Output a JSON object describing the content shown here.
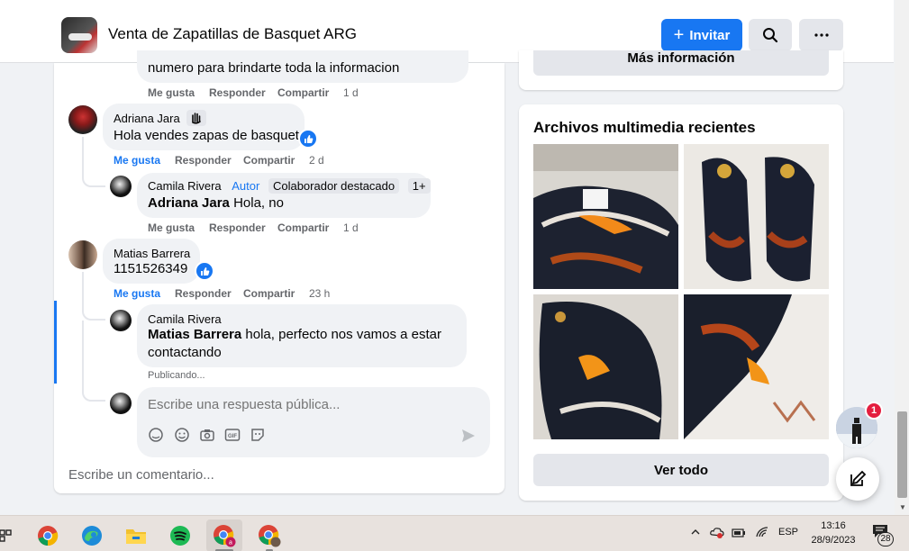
{
  "header": {
    "group_title": "Venta de Zapatillas de Basquet ARG",
    "invite_label": "Invitar"
  },
  "top_partial_text": "numero para brindarte toda la informacion",
  "actions_labels": {
    "like": "Me gusta",
    "reply": "Responder",
    "share": "Compartir"
  },
  "comments": [
    {
      "time": "1 d"
    },
    {
      "author": "Adriana Jara",
      "text": "Hola vendes zapas de basquet",
      "time": "2 d"
    },
    {
      "author": "Camila Rivera",
      "role": "Autor",
      "badge": "Colaborador destacado",
      "badge_count": "1+",
      "mention": "Adriana Jara",
      "text": "Hola, no",
      "time": "1 d"
    },
    {
      "author": "Matias Barrera",
      "text": "1151526349",
      "time": "23 h"
    },
    {
      "author": "Camila Rivera",
      "mention": "Matias Barrera",
      "text_line1": "hola, perfecto nos vamos a estar",
      "text_line2": "contactando",
      "status": "Publicando..."
    }
  ],
  "reply_box": {
    "placeholder": "Escribe una respuesta pública..."
  },
  "write_comment": "Escribe un comentario...",
  "right": {
    "more_info_label": "Más información",
    "media_title": "Archivos multimedia recientes",
    "see_all": "Ver todo"
  },
  "chat": {
    "badge_count": "1"
  },
  "taskbar": {
    "lang": "ESP",
    "time": "13:16",
    "date": "28/9/2023",
    "notif_count": "28"
  },
  "colors": {
    "accent": "#1877f2",
    "bg": "#f0f2f5",
    "badge_red": "#e41e3f"
  }
}
